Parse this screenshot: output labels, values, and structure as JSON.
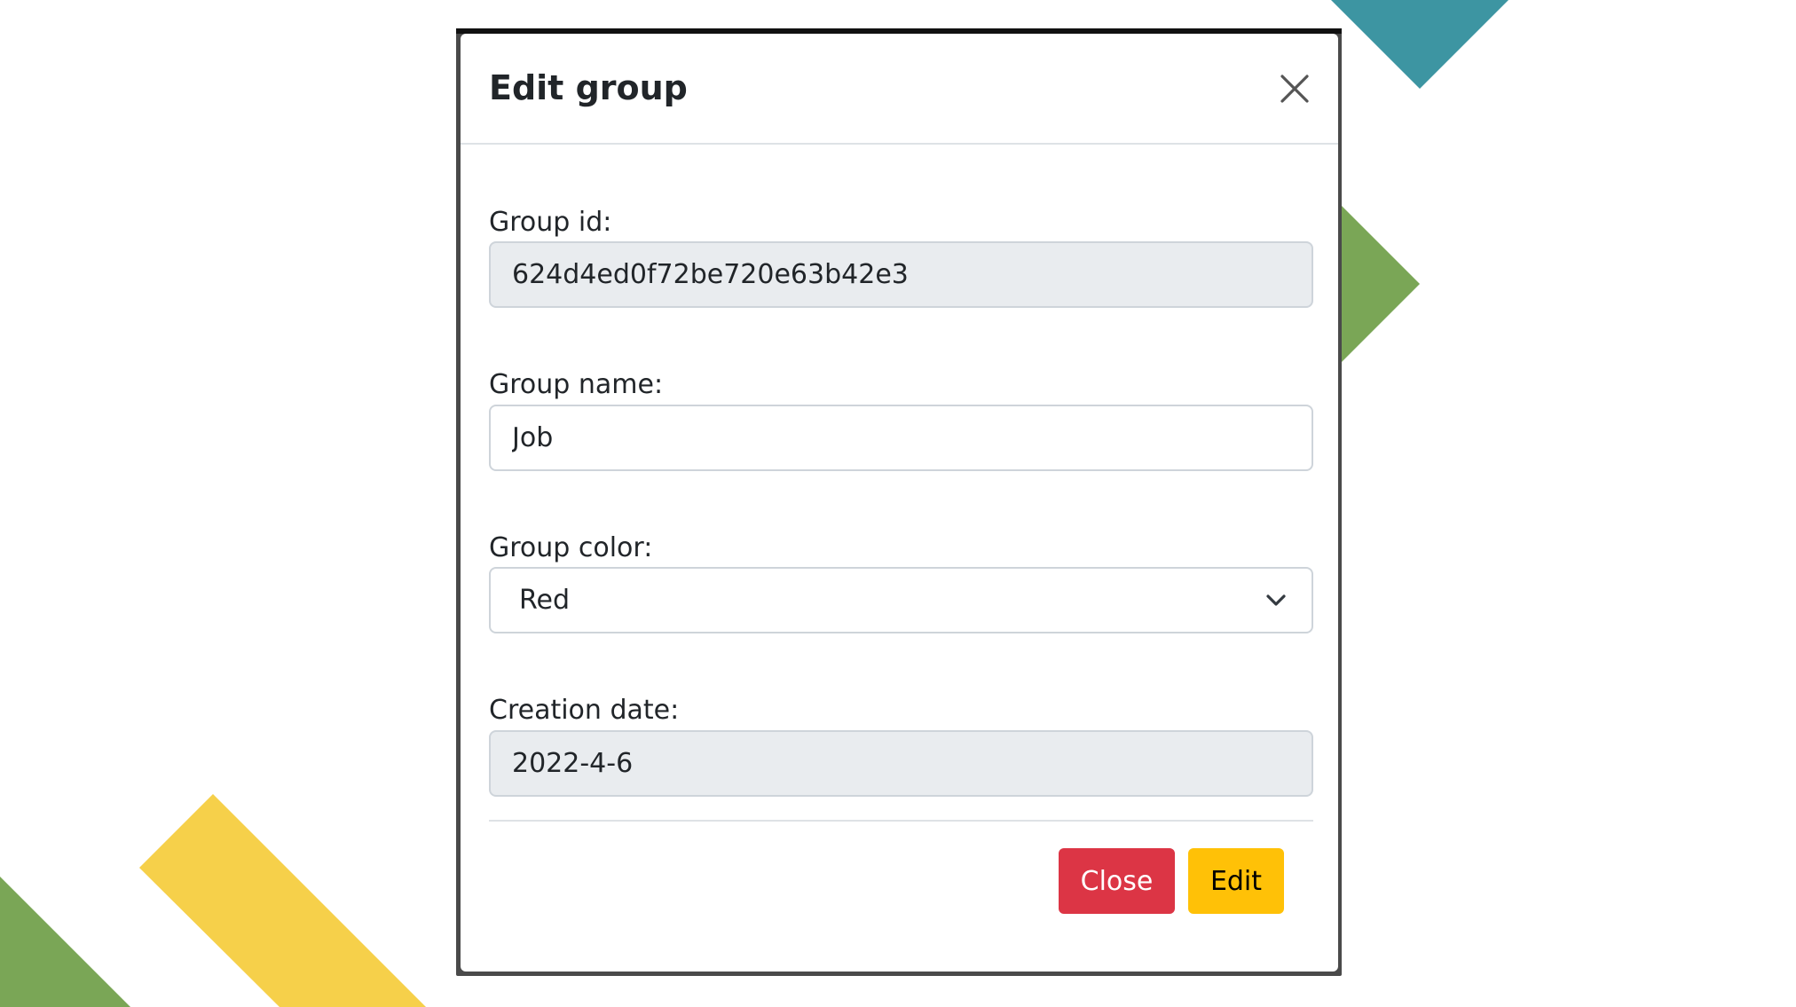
{
  "modal": {
    "title": "Edit group",
    "close_icon": "close-icon"
  },
  "form": {
    "group_id": {
      "label": "Group id:",
      "value": "624d4ed0f72be720e63b42e3",
      "disabled": true
    },
    "group_name": {
      "label": "Group name:",
      "value": "Job"
    },
    "group_color": {
      "label": "Group color:",
      "selected": "Red",
      "icon": "chevron-down-icon"
    },
    "creation_date": {
      "label": "Creation date:",
      "value": "2022-4-6",
      "disabled": true
    }
  },
  "footer": {
    "close_label": "Close",
    "edit_label": "Edit"
  },
  "colors": {
    "close_button": "#dc3545",
    "edit_button": "#ffc107",
    "disabled_field": "#e9ecef",
    "decor_teal": "#3d95a2",
    "decor_green": "#7aa656",
    "decor_yellow": "#f6d04a"
  }
}
